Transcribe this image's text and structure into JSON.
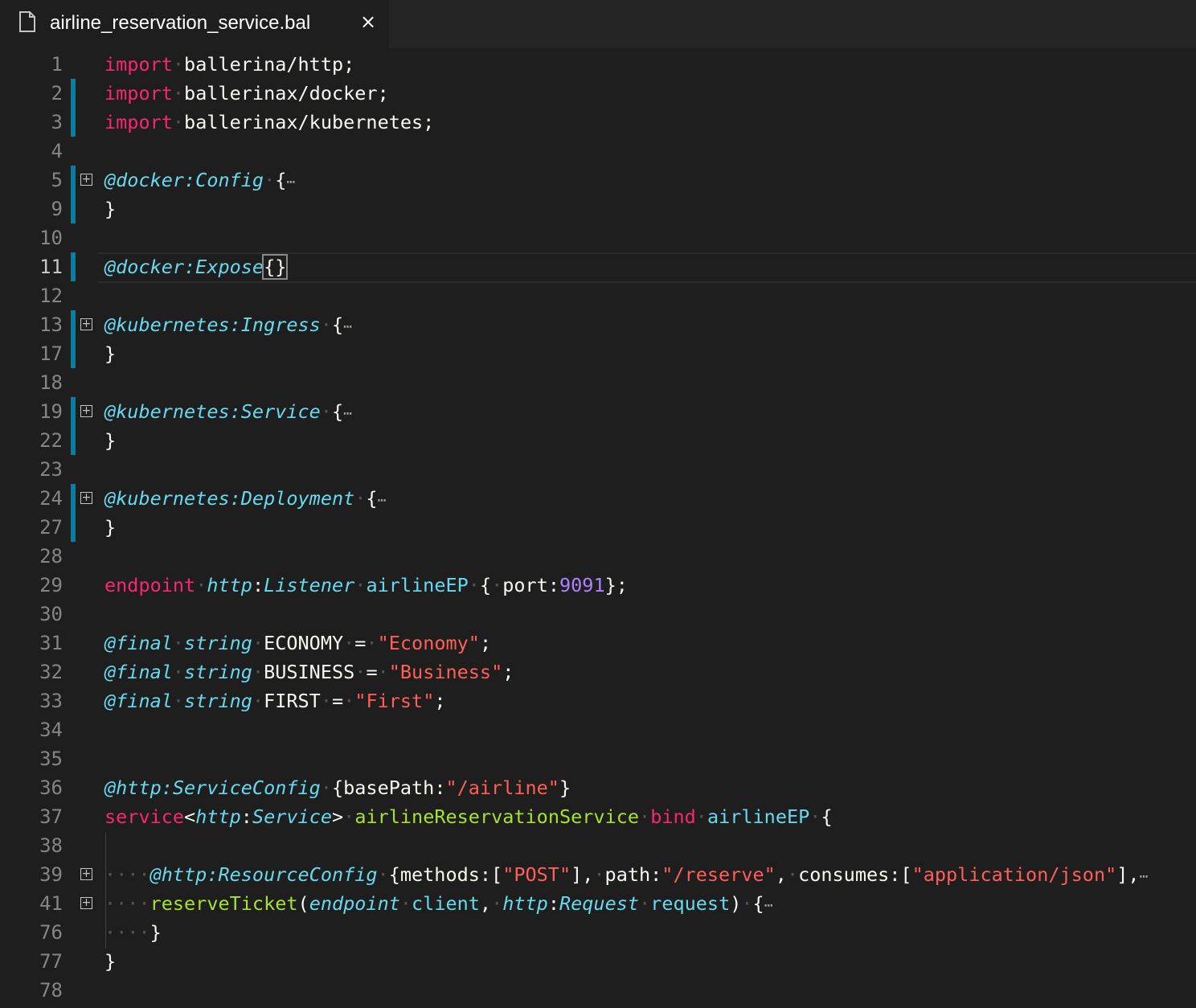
{
  "tab": {
    "filename": "airline_reservation_service.bal",
    "close_glyph": "×",
    "icon": "file-icon"
  },
  "colors": {
    "keyword": "#f92672",
    "annotation": "#66d9ef",
    "string": "#ff5f56",
    "number": "#ae81ff",
    "function": "#a6e22e",
    "gutter_modified": "#0c7d9d"
  },
  "lines": [
    {
      "n": "1",
      "tokens": [
        [
          "kw",
          "import"
        ],
        [
          "dot",
          "·"
        ],
        [
          "id",
          "ballerina/http;"
        ]
      ]
    },
    {
      "n": "2",
      "bar": true,
      "tokens": [
        [
          "kw",
          "import"
        ],
        [
          "dot",
          "·"
        ],
        [
          "id",
          "ballerinax/docker;"
        ]
      ]
    },
    {
      "n": "3",
      "bar": true,
      "tokens": [
        [
          "kw",
          "import"
        ],
        [
          "dot",
          "·"
        ],
        [
          "id",
          "ballerinax/kubernetes;"
        ]
      ]
    },
    {
      "n": "4",
      "tokens": []
    },
    {
      "n": "5",
      "bar": true,
      "fold": true,
      "tokens": [
        [
          "ann",
          "@docker:Config"
        ],
        [
          "dot",
          "·"
        ],
        [
          "pun",
          "{"
        ],
        [
          "ell",
          "⋯"
        ]
      ]
    },
    {
      "n": "9",
      "bar": true,
      "tokens": [
        [
          "pun",
          "}"
        ]
      ]
    },
    {
      "n": "10",
      "tokens": []
    },
    {
      "n": "11",
      "bar": true,
      "current": true,
      "tokens": [
        [
          "ann",
          "@docker:Expose"
        ],
        [
          "box",
          "{}"
        ]
      ]
    },
    {
      "n": "12",
      "tokens": []
    },
    {
      "n": "13",
      "bar": true,
      "fold": true,
      "tokens": [
        [
          "ann",
          "@kubernetes:Ingress"
        ],
        [
          "dot",
          "·"
        ],
        [
          "pun",
          "{"
        ],
        [
          "ell",
          "⋯"
        ]
      ]
    },
    {
      "n": "17",
      "bar": true,
      "tokens": [
        [
          "pun",
          "}"
        ]
      ]
    },
    {
      "n": "18",
      "tokens": []
    },
    {
      "n": "19",
      "bar": true,
      "fold": true,
      "tokens": [
        [
          "ann",
          "@kubernetes:Service"
        ],
        [
          "dot",
          "·"
        ],
        [
          "pun",
          "{"
        ],
        [
          "ell",
          "⋯"
        ]
      ]
    },
    {
      "n": "22",
      "bar": true,
      "tokens": [
        [
          "pun",
          "}"
        ]
      ]
    },
    {
      "n": "23",
      "tokens": []
    },
    {
      "n": "24",
      "bar": true,
      "fold": true,
      "tokens": [
        [
          "ann",
          "@kubernetes:Deployment"
        ],
        [
          "dot",
          "·"
        ],
        [
          "pun",
          "{"
        ],
        [
          "ell",
          "⋯"
        ]
      ]
    },
    {
      "n": "27",
      "bar": true,
      "tokens": [
        [
          "pun",
          "}"
        ]
      ]
    },
    {
      "n": "28",
      "tokens": []
    },
    {
      "n": "29",
      "tokens": [
        [
          "kw",
          "endpoint"
        ],
        [
          "dot",
          "·"
        ],
        [
          "typ",
          "http"
        ],
        [
          "pun",
          ":"
        ],
        [
          "typ",
          "Listener"
        ],
        [
          "dot",
          "·"
        ],
        [
          "var",
          "airlineEP"
        ],
        [
          "dot",
          "·"
        ],
        [
          "pun",
          "{"
        ],
        [
          "dot",
          "·"
        ],
        [
          "id",
          "port:"
        ],
        [
          "num",
          "9091"
        ],
        [
          "pun",
          "};"
        ]
      ]
    },
    {
      "n": "30",
      "tokens": []
    },
    {
      "n": "31",
      "tokens": [
        [
          "ann",
          "@final"
        ],
        [
          "dot",
          "·"
        ],
        [
          "typ",
          "string"
        ],
        [
          "dot",
          "·"
        ],
        [
          "id",
          "ECONOMY"
        ],
        [
          "dot",
          "·"
        ],
        [
          "pun",
          "="
        ],
        [
          "dot",
          "·"
        ],
        [
          "strr",
          "\"Economy\""
        ],
        [
          "pun",
          ";"
        ]
      ]
    },
    {
      "n": "32",
      "tokens": [
        [
          "ann",
          "@final"
        ],
        [
          "dot",
          "·"
        ],
        [
          "typ",
          "string"
        ],
        [
          "dot",
          "·"
        ],
        [
          "id",
          "BUSINESS"
        ],
        [
          "dot",
          "·"
        ],
        [
          "pun",
          "="
        ],
        [
          "dot",
          "·"
        ],
        [
          "strr",
          "\"Business\""
        ],
        [
          "pun",
          ";"
        ]
      ]
    },
    {
      "n": "33",
      "tokens": [
        [
          "ann",
          "@final"
        ],
        [
          "dot",
          "·"
        ],
        [
          "typ",
          "string"
        ],
        [
          "dot",
          "·"
        ],
        [
          "id",
          "FIRST"
        ],
        [
          "dot",
          "·"
        ],
        [
          "pun",
          "="
        ],
        [
          "dot",
          "·"
        ],
        [
          "strr",
          "\"First\""
        ],
        [
          "pun",
          ";"
        ]
      ]
    },
    {
      "n": "34",
      "tokens": []
    },
    {
      "n": "35",
      "tokens": []
    },
    {
      "n": "36",
      "tokens": [
        [
          "ann",
          "@http:ServiceConfig"
        ],
        [
          "dot",
          "·"
        ],
        [
          "pun",
          "{basePath:"
        ],
        [
          "strr",
          "\"/airline\""
        ],
        [
          "pun",
          "}"
        ]
      ]
    },
    {
      "n": "37",
      "tokens": [
        [
          "kw",
          "service"
        ],
        [
          "pun",
          "<"
        ],
        [
          "typ",
          "http"
        ],
        [
          "pun",
          ":"
        ],
        [
          "typ",
          "Service"
        ],
        [
          "pun",
          ">"
        ],
        [
          "dot",
          "·"
        ],
        [
          "fn",
          "airlineReservationService"
        ],
        [
          "dot",
          "·"
        ],
        [
          "kw",
          "bind"
        ],
        [
          "dot",
          "·"
        ],
        [
          "var",
          "airlineEP"
        ],
        [
          "dot",
          "·"
        ],
        [
          "pun",
          "{"
        ]
      ]
    },
    {
      "n": "38",
      "tokens": []
    },
    {
      "n": "39",
      "fold": true,
      "tokens": [
        [
          "dot",
          "····"
        ],
        [
          "ann",
          "@http:ResourceConfig"
        ],
        [
          "dot",
          "·"
        ],
        [
          "pun",
          "{methods:["
        ],
        [
          "strr",
          "\"POST\""
        ],
        [
          "pun",
          "],"
        ],
        [
          "dot",
          "·"
        ],
        [
          "id",
          "path:"
        ],
        [
          "strr",
          "\"/reserve\""
        ],
        [
          "pun",
          ","
        ],
        [
          "dot",
          "·"
        ],
        [
          "id",
          "consumes:["
        ],
        [
          "strr",
          "\"application/json\""
        ],
        [
          "pun",
          "],"
        ],
        [
          "ell",
          "⋯"
        ]
      ]
    },
    {
      "n": "41",
      "fold": true,
      "tokens": [
        [
          "dot",
          "····"
        ],
        [
          "fn",
          "reserveTicket"
        ],
        [
          "pun",
          "("
        ],
        [
          "typ",
          "endpoint"
        ],
        [
          "dot",
          "·"
        ],
        [
          "var",
          "client"
        ],
        [
          "pun",
          ","
        ],
        [
          "dot",
          "·"
        ],
        [
          "typ",
          "http"
        ],
        [
          "pun",
          ":"
        ],
        [
          "typ",
          "Request"
        ],
        [
          "dot",
          "·"
        ],
        [
          "var",
          "request"
        ],
        [
          "pun",
          ")"
        ],
        [
          "dot",
          "·"
        ],
        [
          "pun",
          "{"
        ],
        [
          "ell",
          "⋯"
        ]
      ]
    },
    {
      "n": "76",
      "tokens": [
        [
          "dot",
          "····"
        ],
        [
          "pun",
          "}"
        ]
      ]
    },
    {
      "n": "77",
      "tokens": [
        [
          "pun",
          "}"
        ]
      ]
    },
    {
      "n": "78",
      "tokens": []
    }
  ]
}
